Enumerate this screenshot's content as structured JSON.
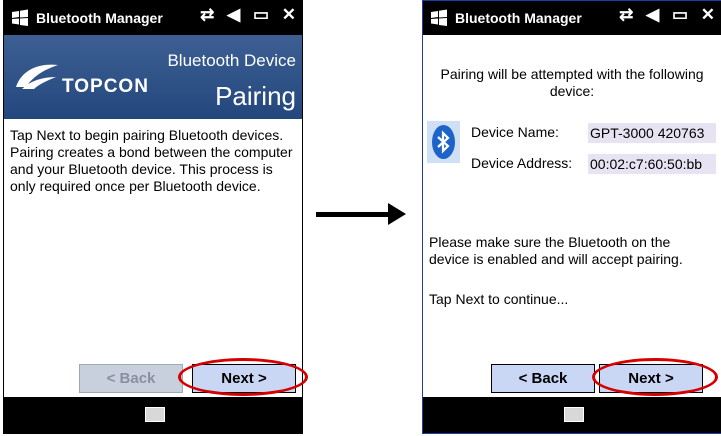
{
  "screen1": {
    "title": "Bluetooth Manager",
    "status_icons": [
      "connectivity-icon",
      "volume-icon",
      "battery-icon",
      "close-icon"
    ],
    "banner": {
      "brand": "TOPCON",
      "heading_line1": "Bluetooth Device",
      "heading_line2": "Pairing"
    },
    "body_text": "Tap Next to begin pairing Bluetooth devices. Pairing creates a bond between the computer and your Bluetooth device. This process is only required once per Bluetooth device.",
    "back_label": "< Back",
    "back_enabled": false,
    "next_label": "Next >"
  },
  "screen2": {
    "title": "Bluetooth Manager",
    "status_icons": [
      "connectivity-icon",
      "volume-icon",
      "battery-icon",
      "close-icon"
    ],
    "intro": "Pairing will be attempted with the following device:",
    "device_name_label": "Device Name:",
    "device_name_value": "GPT-3000 420763",
    "device_address_label": "Device Address:",
    "device_address_value": "00:02:c7:60:50:bb",
    "note": "Please make sure the Bluetooth on the device is enabled and will accept pairing.",
    "continue_text": "Tap Next to continue...",
    "back_label": "< Back",
    "back_enabled": true,
    "next_label": "Next >"
  },
  "colors": {
    "highlight_ring": "#d40000",
    "banner": "#2a4e85",
    "button": "#c9d6f4"
  }
}
